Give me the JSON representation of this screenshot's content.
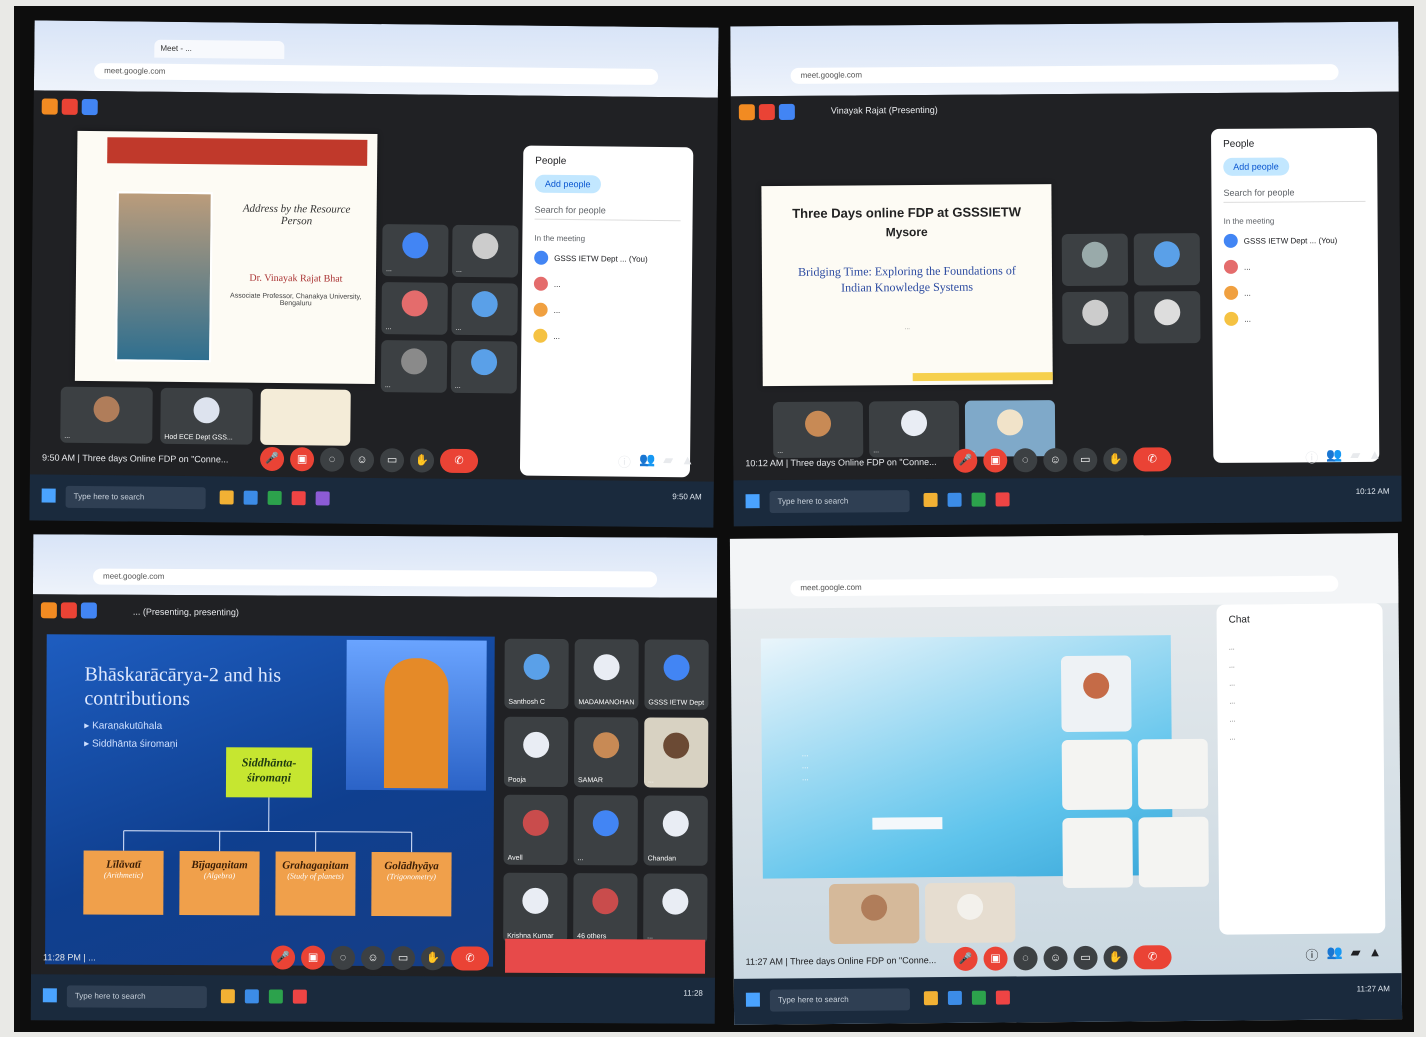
{
  "panel1": {
    "tab_title": "Meet - ...",
    "slide_banner": "...",
    "slide_caption": "Address by the Resource Person",
    "speaker_name": "Dr. Vinayak Rajat Bhat",
    "speaker_role": "Associate Professor, Chanakya University, Bengaluru",
    "people_title": "People",
    "add_people": "Add people",
    "search_people": "Search for people",
    "in_meeting": "In the meeting",
    "participants": [
      "GSSS IETW Dept ... (You)",
      "...",
      "...",
      "..."
    ],
    "tiles": [
      "...",
      "...",
      "...",
      "...",
      "...",
      "..."
    ],
    "bottom_tiles": [
      "...",
      "Hod ECE Dept GSS..."
    ],
    "time_title": "9:50 AM | Three days Online FDP on \"Conne...",
    "taskbar_search": "Type here to search"
  },
  "panel2": {
    "presenting": "Vinayak Rajat (Presenting)",
    "slide_heading": "Three Days online FDP at GSSSIETW",
    "slide_city": "Mysore",
    "slide_subtitle": "Bridging Time: Exploring the Foundations of Indian Knowledge Systems",
    "slide_footer": "...",
    "people_title": "People",
    "add_people": "Add people",
    "search_people": "Search for people",
    "in_meeting": "In the meeting",
    "participants": [
      "GSSS IETW Dept ... (You)",
      "...",
      "...",
      "..."
    ],
    "bottom_tiles": [
      "...",
      "...",
      "..."
    ],
    "time_title": "10:12 AM | Three days Online FDP on \"Conne...",
    "taskbar_search": "Type here to search"
  },
  "panel3": {
    "presenting": "... (Presenting, presenting)",
    "slide_title": "Bhāskarācārya-2 and his contributions",
    "bullets": [
      "Karaṇakutūhala",
      "Siddhānta śiromaṇi"
    ],
    "central_box": "Siddhānta-śiromaṇi",
    "boxes": [
      {
        "title": "Līlāvatī",
        "sub": "(Arithmetic)"
      },
      {
        "title": "Bījagaṇitam",
        "sub": "(Algebra)"
      },
      {
        "title": "Grahagaṇitam",
        "sub": "(Study of planets)"
      },
      {
        "title": "Golādhyāya",
        "sub": "(Trigonometry)"
      }
    ],
    "tiles": [
      "Santhosh C",
      "MADAMANOHAN",
      "GSSS IETW Dept",
      "Pooja",
      "SAMAR",
      "...",
      "Avell",
      "...",
      "Chandan",
      "Krishna Kumar",
      "46 others",
      "..."
    ],
    "time_title": "11:28 PM | ...",
    "taskbar_search": "Type here to search"
  },
  "panel4": {
    "people_title": "Chat",
    "chat_lines": [
      "...",
      "...",
      "...",
      "...",
      "...",
      "..."
    ],
    "slide_lines": [
      "...",
      "...",
      "..."
    ],
    "time_title": "11:27 AM | Three days Online FDP on \"Conne...",
    "taskbar_search": "Type here to search"
  }
}
